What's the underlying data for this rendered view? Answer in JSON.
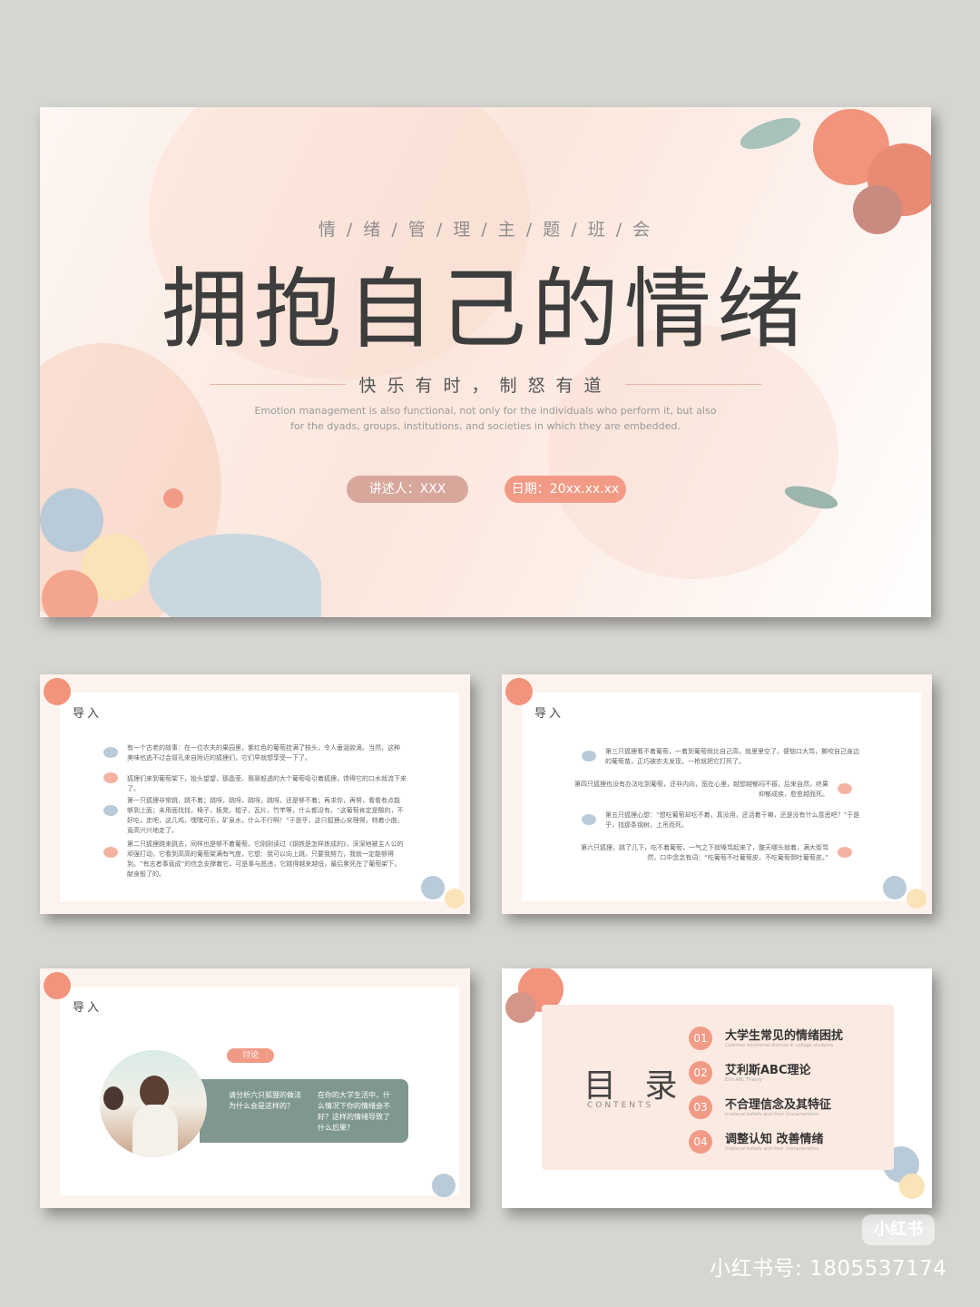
{
  "hero": {
    "subtitle": "情 / 绪 / 管 / 理 / 主 / 题 / 班 / 会",
    "title": "拥抱自己的情绪",
    "tagline": "快乐有时，制怒有道",
    "english": "Emotion management is also functional, not only for the individuals who perform it, but also for the dyads, groups, institutions, and societies in which they are embedded.",
    "speaker": "讲述人：XXX",
    "date": "日期：20xx.xx.xx"
  },
  "slide1": {
    "heading": "导入",
    "paragraphs": [
      "有一个古老的故事：在一位农夫的果园里，紫红色的葡萄挂满了枝头，令人垂涎欲滴。当然，这种美味也逃不过会冒孔来自附近的狐狸们，它们早就想享受一下了。",
      "狐狸们来到葡萄架下，抬头望望，那晶莹、翡翠般透的大个葡萄吸引着狐狸，馋得它的口水就流下来了。",
      "第一只狐狸非常跳，跳不着；跳呀，跳呀，跳呀，跳呀，还是够不着；再求你，再努，看看有点能够到上面；未用面找找，椅子，板凳，棍子，瓦片，竹竿等，什么都没有。“这葡萄肯定是酸的，不好吃，走吧，这几鸡，嘿嘿可乐，矿泉水，什么不行啊！”于是乎，这只狐狸心安理得，特着小曲，竟高兴兴地走了。",
      "第二只狐狸跳来跳去，同样也是够不着葡萄，它刚刚读过《钢铁是怎样炼成的》，深深地被主人公的顽强打动，它看到高高的葡萄架满有气度，它想：我可以向上跳，只要我努力，我就一定能够得到。“有志者事竟成”的信念支撑着它，可是事与愿违，它跳得越来越低，最后累死在了葡萄架下，献身般了的。"
    ]
  },
  "slide2": {
    "heading": "导入",
    "paragraphs": [
      "第三只狐狸看不着葡萄，一着到葡萄就比自己高，就里里空了。便恼口大骂，撕咬自己身边的葡萄苗，正巧被农夫发现，一枪就把它打死了。",
      "第四只狐狸也没有办法吃到葡萄，还非内向，宽在心里，越想越郁闷不振，后来自然，终果抑郁成疾，愈愈越而死。",
      "第五只狐狸心想：“想吃葡萄却吃不着，真没用，还活着干嘛，还是没有什么意思吧？”于是乎，找那条钢树，上吊而死。",
      "第六只狐狸，跳了几下，吃不着葡萄，一气之下就嗓骂起来了，整天哪头就着，满大街骂然，口中念念有词：“吃葡萄不吐葡萄皮，不吃葡萄倒吐葡萄皮。”"
    ]
  },
  "slide3": {
    "heading": "导入",
    "badge": "讨论",
    "question_left": "请分析六只狐狸的做法为什么会是这样的？",
    "question_right": "在你的大学生活中，什么情况下你的情绪会不好？这样的情绪导致了什么后果？"
  },
  "slide4": {
    "title": "目 录",
    "contents_label": "CONTENTS",
    "items": [
      {
        "num": "01",
        "label": "大学生常见的情绪困扰",
        "sub": "Common emotional distress in college students"
      },
      {
        "num": "02",
        "label": "艾利斯ABC理论",
        "sub": "Ellis ABC Theory"
      },
      {
        "num": "03",
        "label": "不合理信念及其特征",
        "sub": "Irrational beliefs and their characteristics"
      },
      {
        "num": "04",
        "label": "调整认知 改善情绪",
        "sub": "Irrational beliefs and their characteristics"
      }
    ]
  },
  "watermark": {
    "badge": "小红书",
    "text": "小红书号: 1805537174"
  },
  "colors": {
    "coral": "#f19b86",
    "rose": "#d7a79c",
    "sage": "#7f9790",
    "background": "#d6d5d1"
  }
}
